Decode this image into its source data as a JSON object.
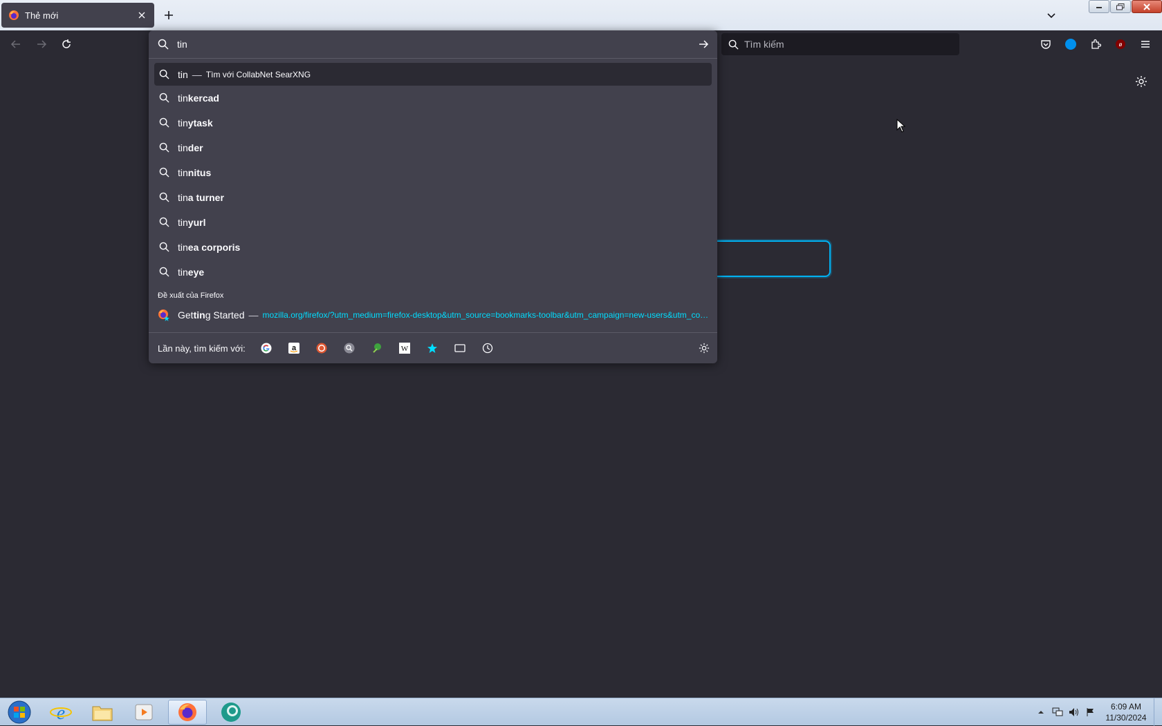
{
  "browser": {
    "tab": {
      "title": "Thẻ mới"
    },
    "search_box": {
      "placeholder": "Tìm kiếm"
    }
  },
  "urlbar": {
    "value": "tin",
    "first_result": {
      "text": "tin",
      "dash": "—",
      "action": "Tìm với CollabNet SearXNG"
    },
    "suggestions": [
      {
        "prefix": "tin",
        "rest": "kercad"
      },
      {
        "prefix": "tin",
        "rest": "ytask"
      },
      {
        "prefix": "tin",
        "rest": "der"
      },
      {
        "prefix": "tin",
        "rest": "nitus"
      },
      {
        "prefix": "tin",
        "rest": "a turner"
      },
      {
        "prefix": "tin",
        "rest": "yurl"
      },
      {
        "prefix": "tin",
        "rest": "ea corporis"
      },
      {
        "prefix": "tin",
        "rest": "eye"
      }
    ],
    "group_label": "Đề xuất của Firefox",
    "firefox_suggest": {
      "title_pre": "Get",
      "title_bold": "tin",
      "title_post": "g Started",
      "dash": "—",
      "url": "mozilla.org/firefox/?utm_medium=firefox-desktop&utm_source=bookmarks-toolbar&utm_campaign=new-users&utm_content=-global"
    },
    "oneoff": {
      "label": "Lần này, tìm kiếm với:",
      "engines": [
        "google-icon",
        "amazon-icon",
        "duckduckgo-icon",
        "searxng-icon",
        "ecosia-icon",
        "wikipedia-icon",
        "bookmarks-icon",
        "tabs-icon",
        "history-icon"
      ]
    }
  },
  "taskbar": {
    "clock": {
      "time": "6:09 AM",
      "date": "11/30/2024"
    }
  },
  "colors": {
    "accent": "#00ddff",
    "focus_ring": "#00b3f4",
    "panel": "#42414d",
    "page_bg": "#2b2a33"
  }
}
